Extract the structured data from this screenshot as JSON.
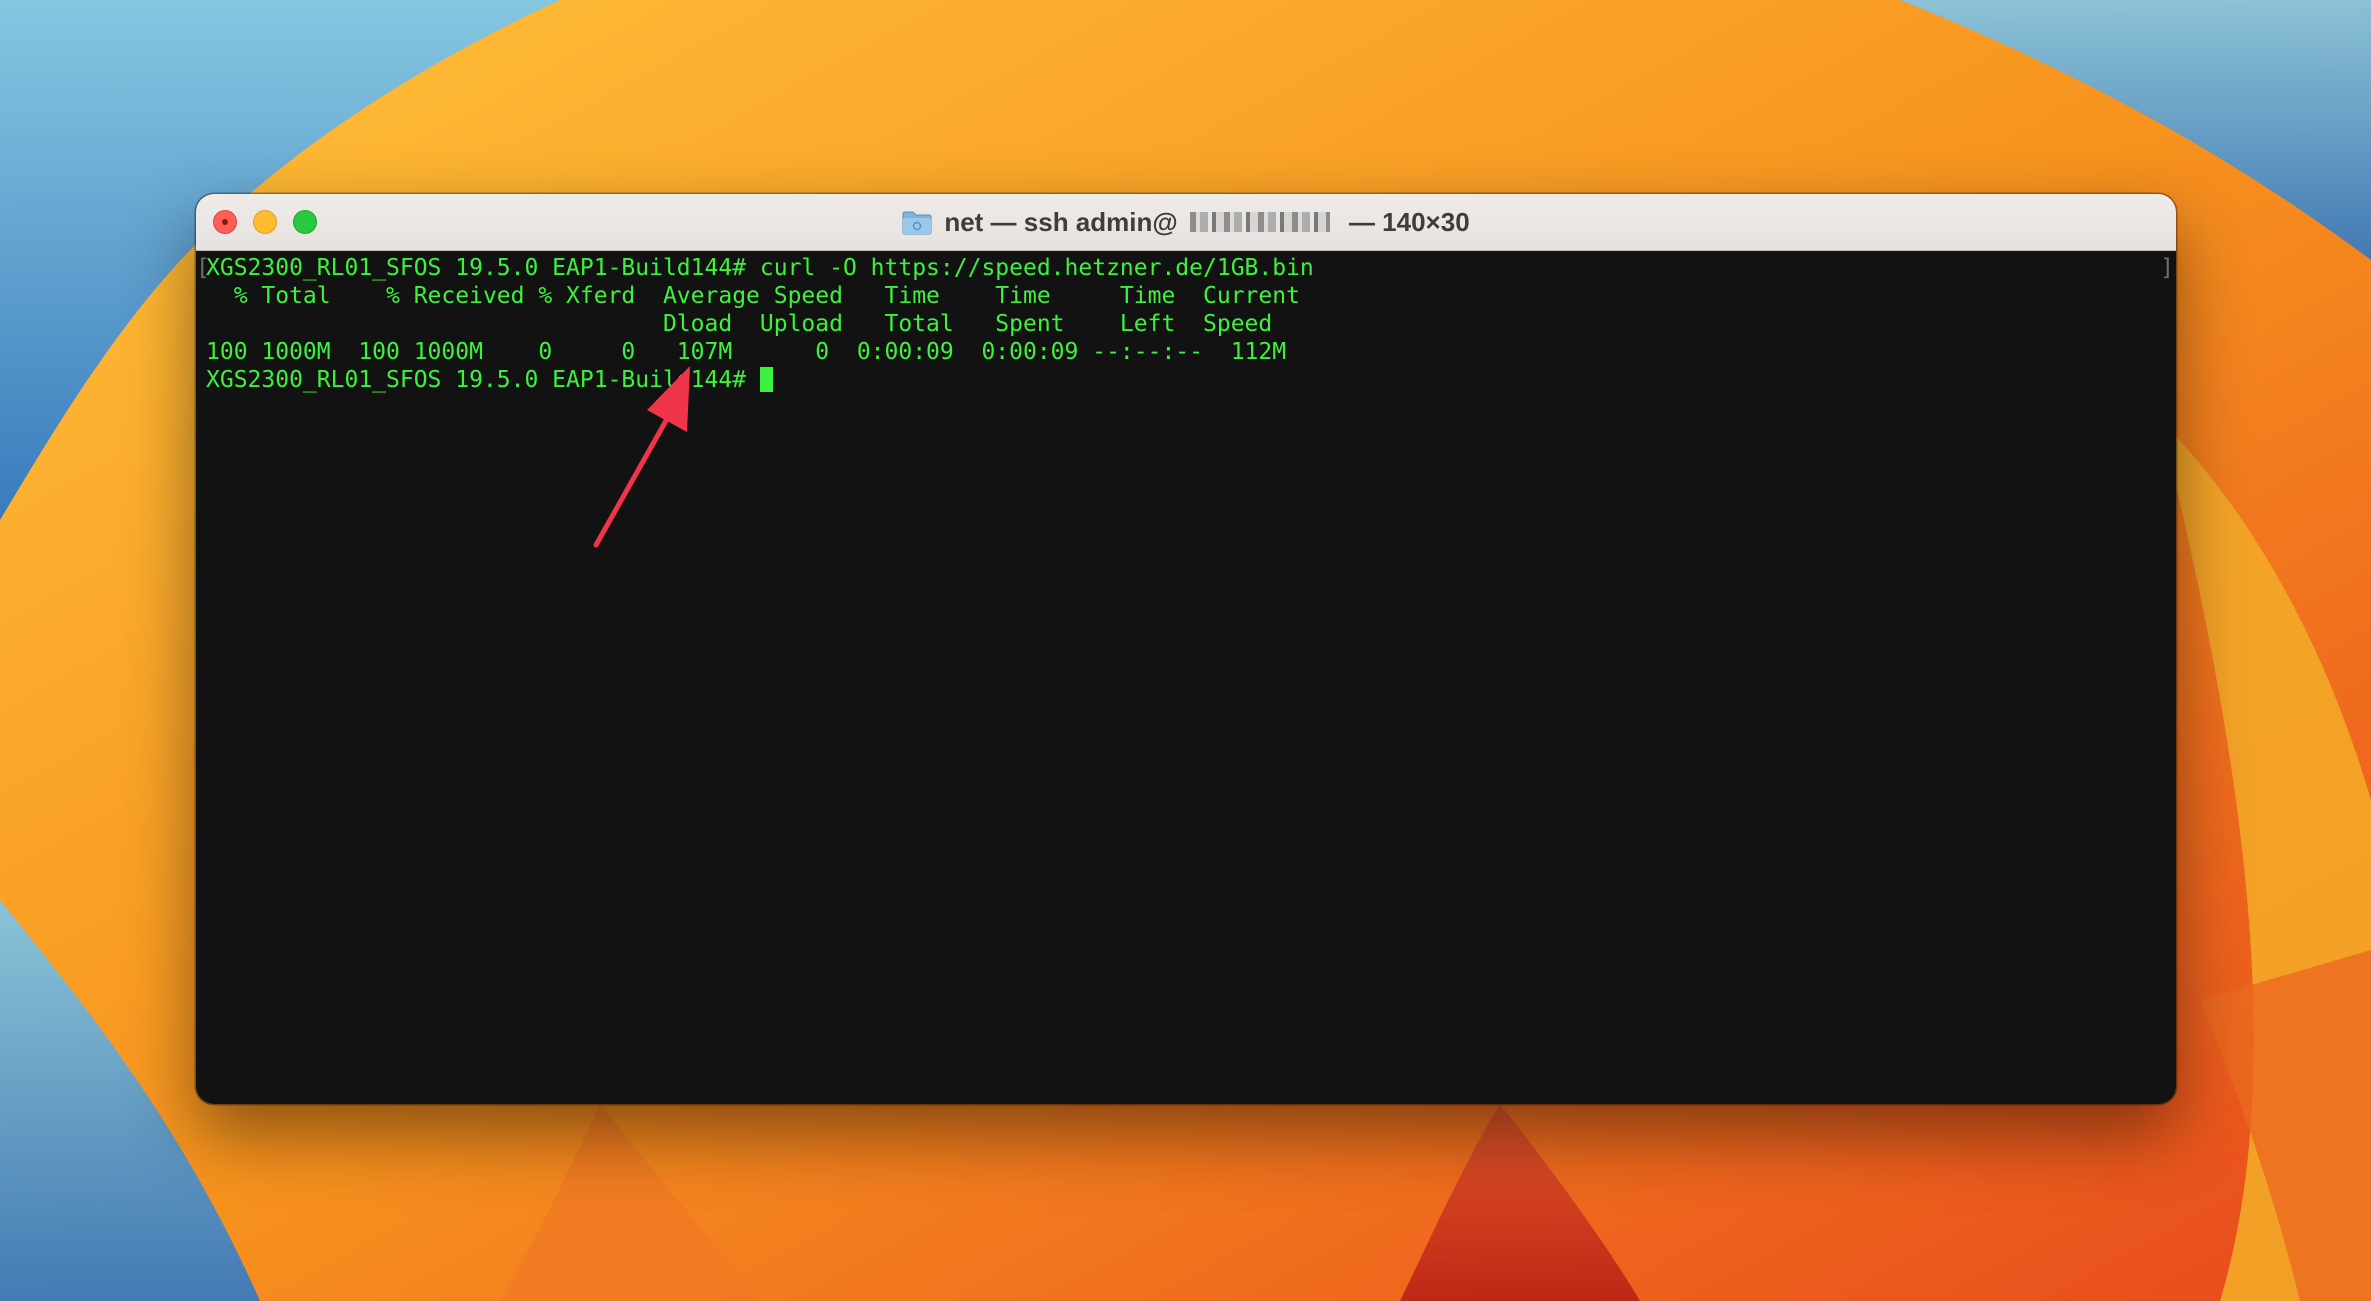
{
  "window": {
    "title_prefix": "net — ssh admin@",
    "title_suffix": " — 140×30"
  },
  "terminal": {
    "lines": [
      "XGS2300_RL01_SFOS 19.5.0 EAP1-Build144# curl -O https://speed.hetzner.de/1GB.bin",
      "  % Total    % Received % Xferd  Average Speed   Time    Time     Time  Current",
      "                                 Dload  Upload   Total   Spent    Left  Speed",
      "100 1000M  100 1000M    0     0   107M      0  0:00:09  0:00:09 --:--:--  112M"
    ],
    "prompt": "XGS2300_RL01_SFOS 19.5.0 EAP1-Build144# "
  },
  "colors": {
    "terminal_text": "#3cf23c",
    "terminal_background": "#121212",
    "annotation_arrow": "#f0344a"
  },
  "icons": {
    "title_icon": "folder-icon"
  }
}
